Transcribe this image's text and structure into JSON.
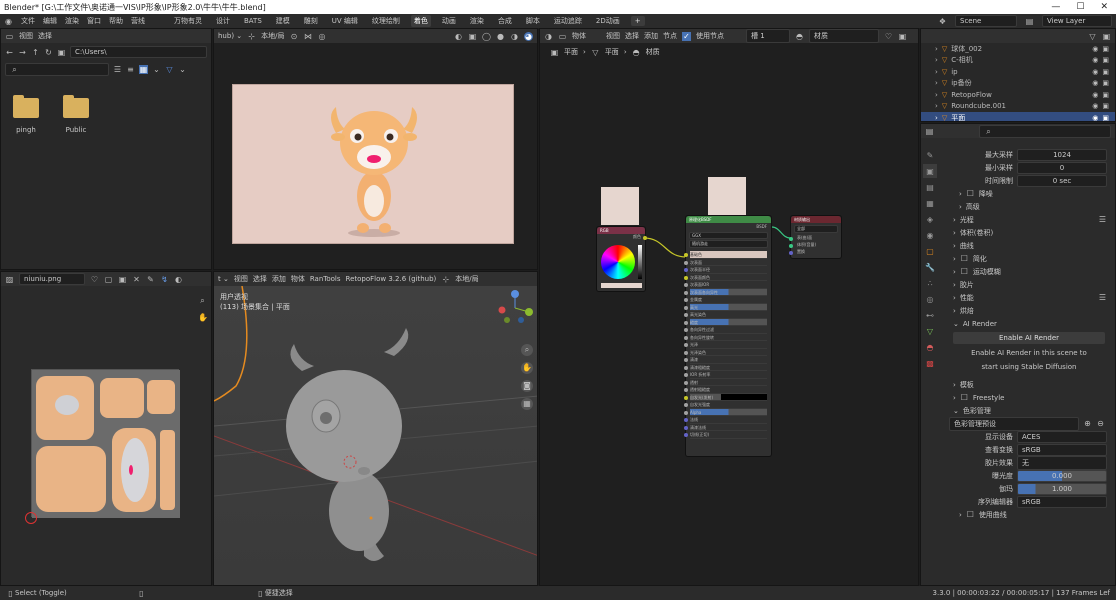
{
  "window": {
    "title": "Blender* [G:\\工作文件\\奥诺通一VIS\\IP形象\\IP形象2.0\\牛牛\\牛牛.blend]",
    "minimize": "—",
    "maximize": "☐",
    "close": "✕"
  },
  "menu": {
    "items": [
      "文件",
      "编辑",
      "渲染",
      "窗口",
      "帮助",
      "营线"
    ],
    "workspaces": [
      "万物有灵",
      "设计",
      "BATS",
      "建模",
      "雕刻",
      "UV 编辑",
      "纹理绘制",
      "着色",
      "动画",
      "渲染",
      "合成",
      "脚本",
      "运动追踪",
      "2D动画"
    ],
    "active_workspace": "着色",
    "scene": "Scene",
    "view_layer": "View Layer"
  },
  "file_browser": {
    "view": "视图",
    "select": "选择",
    "path": "C:\\Users\\",
    "files": [
      {
        "name": "pingh"
      },
      {
        "name": "Public"
      }
    ]
  },
  "image_editor": {
    "image": "niuniu.png"
  },
  "viewport3d": {
    "header_items": [
      "视图",
      "选择",
      "添加",
      "物体",
      "RanTools",
      "RetopoFlow 3.2.6 (github)",
      "本地/局"
    ],
    "overlay_line1": "用户透视",
    "overlay_line2": "(113) 场景集合 | 平面"
  },
  "render_preview": {
    "mode": "本地/局"
  },
  "node_editor": {
    "type": "物体",
    "menus": [
      "视图",
      "选择",
      "添加",
      "节点"
    ],
    "use_nodes": "使用节点",
    "slot": "槽 1",
    "material": "材质",
    "breadcrumb": [
      "平面",
      "平面",
      "材质"
    ],
    "rgb_node": {
      "title": "RGB",
      "output": "颜色"
    },
    "bsdf_node": {
      "title": "原理化BSDF",
      "output": "BSDF",
      "dist": "GGX",
      "sss": "随机游走",
      "fields": [
        "基础色",
        "次表面",
        "次表面半径",
        "次表面颜色",
        "次表面IOR",
        "次表面各向异性",
        "金属度",
        "高光",
        "高光染色",
        "糙度",
        "各向异性过滤",
        "各向异性旋转",
        "光泽",
        "光泽染色",
        "清漆",
        "清漆粗糙度",
        "IOR 折射率",
        "透射",
        "透射粗糙度",
        "自发光(发射)",
        "自发光强度",
        "Alpha",
        "法线",
        "清漆法线",
        "切线(正切)"
      ]
    },
    "output_node": {
      "title": "材质输出",
      "target": "全部",
      "sockets": [
        "表(曲)面",
        "体积(音量)",
        "置换"
      ]
    }
  },
  "outliner": {
    "items": [
      "球体_002",
      "C-相机",
      "ip",
      "ip备份",
      "RetopoFlow",
      "Roundcube.001",
      "平面"
    ],
    "selected": "平面"
  },
  "properties": {
    "search_placeholder": "",
    "rows": [
      {
        "label": "最大采样",
        "value": "1024"
      },
      {
        "label": "最小采样",
        "value": "0"
      },
      {
        "label": "时间限制",
        "value": "0 sec"
      }
    ],
    "sections": [
      "降噪",
      "高级",
      "光程",
      "体积(卷积)",
      "曲线",
      "简化",
      "运动模糊",
      "胶片",
      "性能",
      "烘焙"
    ],
    "ai": {
      "title": "AI Render",
      "button": "Enable AI Render",
      "line1": "Enable AI Render in this scene to",
      "line2": "start using Stable Diffusion"
    },
    "sections2": [
      "模板",
      "Freestyle",
      "色彩管理"
    ],
    "cm": {
      "preset": "色彩管理预设",
      "display": {
        "label": "显示设备",
        "value": "ACES"
      },
      "view": {
        "label": "查看变换",
        "value": "sRGB"
      },
      "look": {
        "label": "胶片效果",
        "value": "无"
      },
      "exposure": {
        "label": "曝光度",
        "value": "0.000"
      },
      "gamma": {
        "label": "伽玛",
        "value": "1.000"
      },
      "sequencer": {
        "label": "序列编辑器",
        "value": "sRGB"
      },
      "curves": "使用曲线"
    }
  },
  "status": {
    "left": "Select (Toggle)",
    "mid": "便捷选择",
    "right": "3.3.0 | 00:00:03:22 / 00:00:05:17 | 137 Frames Lef"
  },
  "colors": {
    "accent": "#4772b3",
    "active_blue": "#2e5b9a",
    "selected": "#334d80",
    "node_shader": "#3f8b46",
    "node_input": "#7a3147",
    "node_output": "#6b2730",
    "uv_orange": "#e9b486"
  }
}
